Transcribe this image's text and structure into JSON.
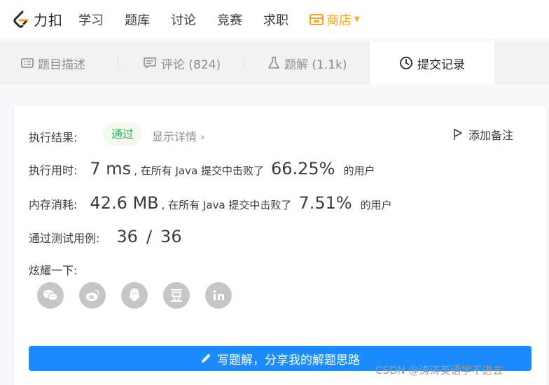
{
  "app": {
    "brand_name": "力扣",
    "brand_color": "#ffa116"
  },
  "nav": {
    "items": [
      "学习",
      "题库",
      "讨论",
      "竞赛",
      "求职"
    ],
    "store_label": "商店"
  },
  "tabs": [
    {
      "label": "题目描述",
      "icon": "description-icon"
    },
    {
      "label": "评论 (824)",
      "icon": "comment-icon"
    },
    {
      "label": "题解 (1.1k)",
      "icon": "flask-icon"
    },
    {
      "label": "提交记录",
      "icon": "clock-icon",
      "active": true
    }
  ],
  "result": {
    "status_label": "执行结果:",
    "status_value": "通过",
    "detail_link": "显示详情",
    "add_note": "添加备注",
    "runtime_label": "执行用时:",
    "runtime_value": "7 ms",
    "runtime_text": ", 在所有 Java 提交中击败了",
    "runtime_percent": "66.25%",
    "runtime_suffix": "的用户",
    "memory_label": "内存消耗:",
    "memory_value": "42.6 MB",
    "memory_text": ", 在所有 Java 提交中击败了",
    "memory_percent": "7.51%",
    "memory_suffix": "的用户",
    "tests_label": "通过测试用例:",
    "tests_passed": "36",
    "tests_sep": "/",
    "tests_total": "36"
  },
  "share": {
    "label": "炫耀一下:",
    "buttons": [
      "wechat-icon",
      "weibo-icon",
      "qq-icon",
      "douban-icon",
      "linkedin-icon"
    ]
  },
  "write_button": "写题解，分享我的解题思路",
  "watermark": "CSDN @涛涛英语学不进去"
}
